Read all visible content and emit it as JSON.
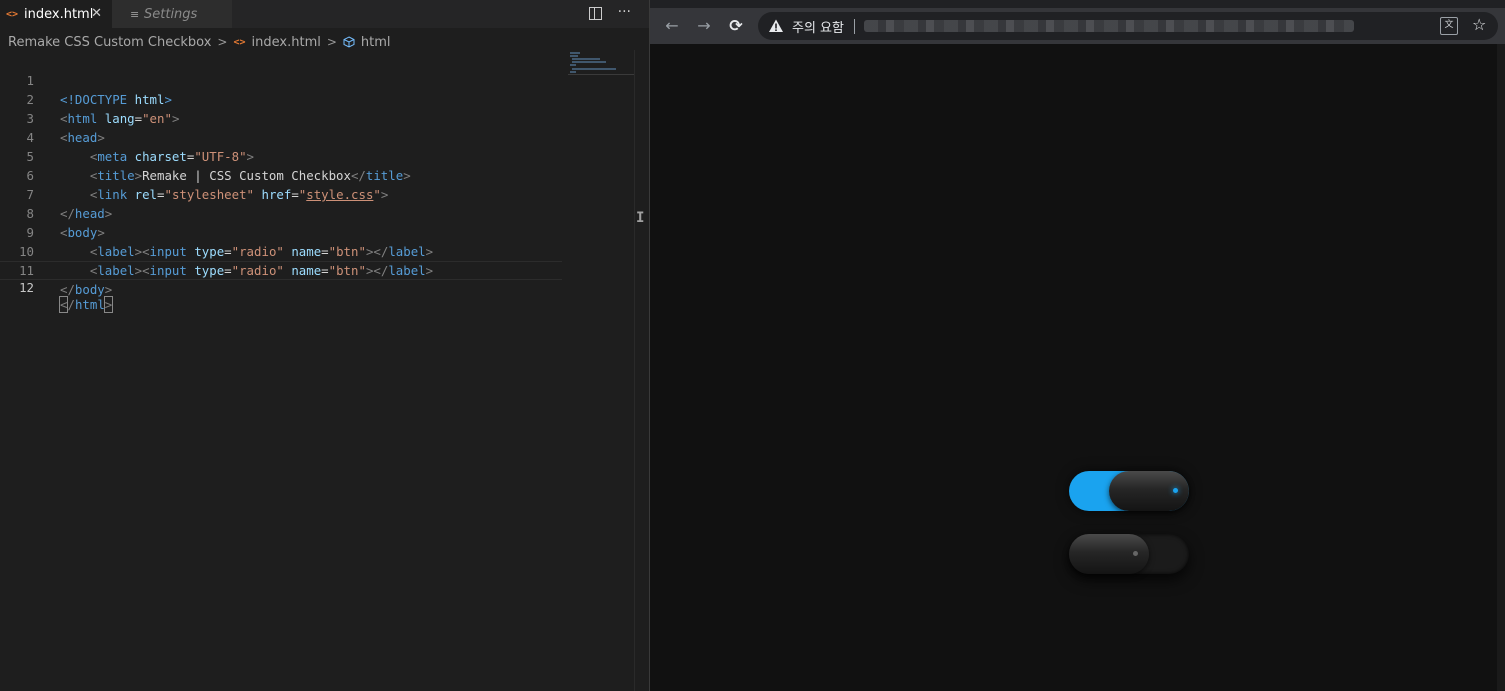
{
  "editor": {
    "tabs": [
      {
        "label": "index.html",
        "icon": "html-file-icon",
        "active": true
      },
      {
        "label": "Settings",
        "icon": "settings-list-icon",
        "active": false
      }
    ],
    "breadcrumb": [
      "Remake CSS Custom Checkbox",
      "index.html",
      "html"
    ],
    "line_numbers": [
      "1",
      "2",
      "3",
      "4",
      "5",
      "6",
      "7",
      "8",
      "9",
      "10",
      "11",
      "12"
    ],
    "current_line": "12",
    "lines": {
      "l1": [
        "<!DOCTYPE ",
        "html",
        ">"
      ],
      "l2": [
        "<",
        "html",
        " ",
        "lang",
        "=",
        "\"en\"",
        ">"
      ],
      "l3": [
        "<",
        "head",
        ">"
      ],
      "l4": [
        "    <",
        "meta",
        " ",
        "charset",
        "=",
        "\"UTF-8\"",
        ">"
      ],
      "l5": [
        "    <",
        "title",
        ">",
        "Remake | CSS Custom Checkbox",
        "</",
        "title",
        ">"
      ],
      "l6": [
        "    <",
        "link",
        " ",
        "rel",
        "=",
        "\"stylesheet\"",
        " ",
        "href",
        "=",
        "\"",
        "style.css",
        "\"",
        ">"
      ],
      "l7": [
        "</",
        "head",
        ">"
      ],
      "l8": [
        "<",
        "body",
        ">"
      ],
      "l9": [
        "    <",
        "label",
        "><",
        "input",
        " ",
        "type",
        "=",
        "\"radio\"",
        " ",
        "name",
        "=",
        "\"btn\"",
        "></",
        "label",
        ">"
      ],
      "l10": [
        "    <",
        "label",
        "><",
        "input",
        " ",
        "type",
        "=",
        "\"radio\"",
        " ",
        "name",
        "=",
        "\"btn\"",
        "></",
        "label",
        ">"
      ],
      "l11": [
        "</",
        "body",
        ">"
      ],
      "l12": [
        "<",
        "/",
        "html",
        ">"
      ]
    },
    "text_cursor_glyph": "I"
  },
  "browser": {
    "back_icon": "←",
    "forward_icon": "→",
    "reload_icon": "⟳",
    "security_warning": "주의 요함",
    "translate_icon": "文",
    "bookmark_icon": "☆",
    "toggles": [
      {
        "name": "btn",
        "checked": true,
        "accent": "#1aa3ef"
      },
      {
        "name": "btn",
        "checked": false
      }
    ]
  },
  "colors": {
    "editor_bg": "#1e1e1e",
    "browser_bg": "#111111",
    "toggle_accent": "#1aa3ef",
    "tag": "#569cd6",
    "attr": "#9cdcfe",
    "string": "#ce9178"
  }
}
